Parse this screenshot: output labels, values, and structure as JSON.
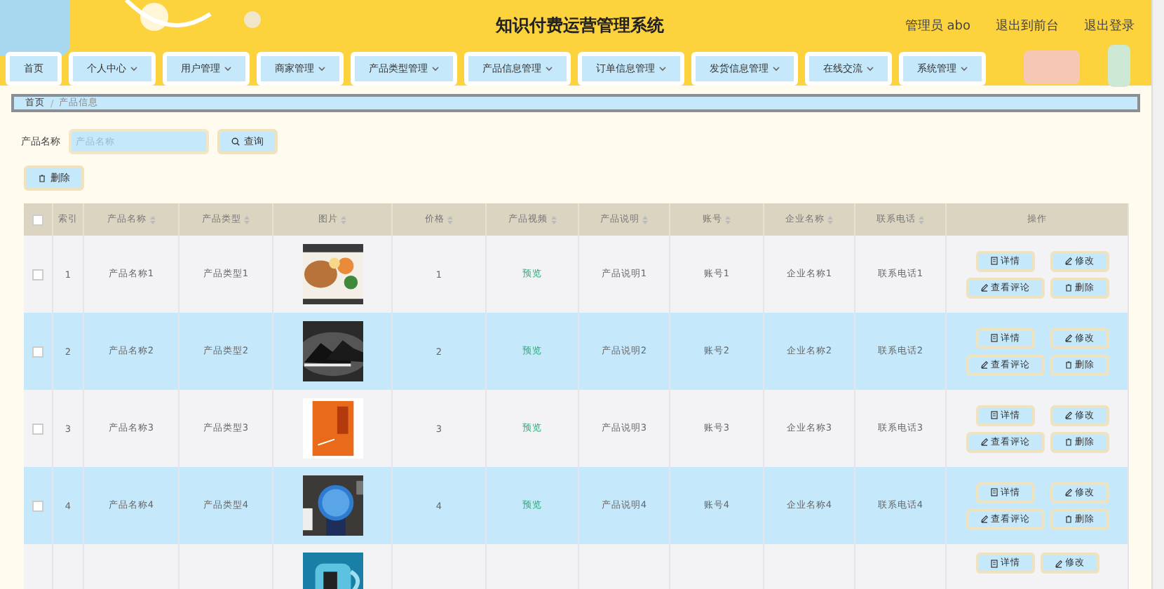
{
  "header": {
    "title": "知识付费运营管理系统",
    "user": "管理员 abo",
    "links": [
      "退出到前台",
      "退出登录"
    ]
  },
  "nav": [
    {
      "label": "首页",
      "dropdown": false
    },
    {
      "label": "个人中心",
      "dropdown": true
    },
    {
      "label": "用户管理",
      "dropdown": true
    },
    {
      "label": "商家管理",
      "dropdown": true
    },
    {
      "label": "产品类型管理",
      "dropdown": true
    },
    {
      "label": "产品信息管理",
      "dropdown": true
    },
    {
      "label": "订单信息管理",
      "dropdown": true
    },
    {
      "label": "发货信息管理",
      "dropdown": true
    },
    {
      "label": "在线交流",
      "dropdown": true
    },
    {
      "label": "系统管理",
      "dropdown": true
    }
  ],
  "breadcrumb": {
    "items": [
      "首页",
      "产品信息"
    ],
    "separator": "/"
  },
  "search": {
    "label": "产品名称",
    "placeholder": "产品名称",
    "button": "查询"
  },
  "delete_button": "删除",
  "table": {
    "columns": [
      {
        "kind": "checkbox",
        "checked": false
      },
      {
        "label": "索引",
        "sortable": false
      },
      {
        "label": "产品名称",
        "sortable": true
      },
      {
        "label": "产品类型",
        "sortable": true
      },
      {
        "label": "图片",
        "sortable": true
      },
      {
        "label": "价格",
        "sortable": true
      },
      {
        "label": "产品视频",
        "sortable": true
      },
      {
        "label": "产品说明",
        "sortable": true
      },
      {
        "label": "账号",
        "sortable": true
      },
      {
        "label": "企业名称",
        "sortable": true
      },
      {
        "label": "联系电话",
        "sortable": true
      },
      {
        "label": "操作",
        "sortable": false
      }
    ],
    "rows": [
      {
        "cells": [
          {
            "kind": "checkbox",
            "checked": false
          },
          "1",
          "产品名称1",
          "产品类型1",
          {
            "kind": "picture"
          },
          "1",
          {
            "kind": "link",
            "text": "预览"
          },
          "产品说明1",
          "账号1",
          "企业名称1",
          "联系电话1",
          {
            "kind": "actions",
            "buttons": [
              "详情",
              "修改",
              "查看评论",
              "删除"
            ]
          }
        ]
      },
      {
        "cells": [
          {
            "kind": "checkbox",
            "checked": false
          },
          "2",
          "产品名称2",
          "产品类型2",
          {
            "kind": "picture"
          },
          "2",
          {
            "kind": "link",
            "text": "预览"
          },
          "产品说明2",
          "账号2",
          "企业名称2",
          "联系电话2",
          {
            "kind": "actions",
            "buttons": [
              "详情",
              "修改",
              "查看评论",
              "删除"
            ]
          }
        ]
      },
      {
        "cells": [
          {
            "kind": "checkbox",
            "checked": false
          },
          "3",
          "产品名称3",
          "产品类型3",
          {
            "kind": "picture"
          },
          "3",
          {
            "kind": "link",
            "text": "预览"
          },
          "产品说明3",
          "账号3",
          "企业名称3",
          "联系电话3",
          {
            "kind": "actions",
            "buttons": [
              "详情",
              "修改",
              "查看评论",
              "删除"
            ]
          }
        ]
      },
      {
        "cells": [
          {
            "kind": "checkbox",
            "checked": false
          },
          "4",
          "产品名称4",
          "产品类型4",
          {
            "kind": "picture"
          },
          "4",
          {
            "kind": "link",
            "text": "预览"
          },
          "产品说明4",
          "账号4",
          "企业名称4",
          "联系电话4",
          {
            "kind": "actions",
            "buttons": [
              "详情",
              "修改",
              "查看评论",
              "删除"
            ]
          }
        ]
      },
      {
        "cells": [
          null,
          null,
          null,
          null,
          {
            "kind": "picture"
          },
          null,
          null,
          null,
          null,
          null,
          null,
          {
            "kind": "actions",
            "buttons": [
              "详情",
              "修改"
            ]
          }
        ]
      }
    ]
  }
}
